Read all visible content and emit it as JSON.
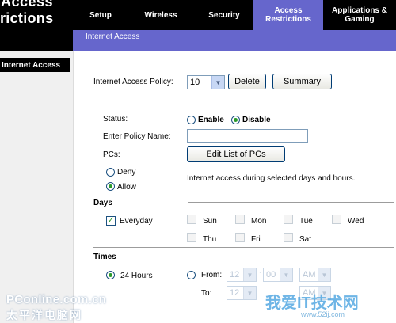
{
  "brand": {
    "line1": "Access",
    "line2": "rictions"
  },
  "nav": {
    "tabs": [
      {
        "label": "Setup"
      },
      {
        "label": "Wireless"
      },
      {
        "label": "Security"
      },
      {
        "label": "Access Restrictions"
      },
      {
        "label": "Applications & Gaming"
      }
    ],
    "sub_item": "Internet Access"
  },
  "sidebar": {
    "section_label": "Internet Access"
  },
  "policy": {
    "label": "Internet Access Policy:",
    "selected": "10",
    "delete_label": "Delete",
    "summary_label": "Summary"
  },
  "status": {
    "label": "Status:",
    "enable": "Enable",
    "disable": "Disable",
    "selected": "Disable"
  },
  "policy_name": {
    "label": "Enter Policy Name:",
    "value": ""
  },
  "pcs": {
    "label": "PCs:",
    "button": "Edit List of PCs"
  },
  "access": {
    "deny": "Deny",
    "allow": "Allow",
    "selected": "Allow",
    "note": "Internet access during selected days and hours."
  },
  "days": {
    "title": "Days",
    "everyday": "Everyday",
    "list": [
      "Sun",
      "Mon",
      "Tue",
      "Wed",
      "Thu",
      "Fri",
      "Sat"
    ]
  },
  "times": {
    "title": "Times",
    "hours24": "24 Hours",
    "from": "From:",
    "to": "To:",
    "from_hour": "12",
    "from_min": "00",
    "from_ampm": "AM",
    "to_hour": "12",
    "to_ampm": "AM"
  },
  "watermarks": {
    "pconline": "PConline.com.cn",
    "pconline_cn": "太平洋电脑网",
    "site_cn": "我爱IT技术网",
    "site_url": "www.52ij.com"
  }
}
